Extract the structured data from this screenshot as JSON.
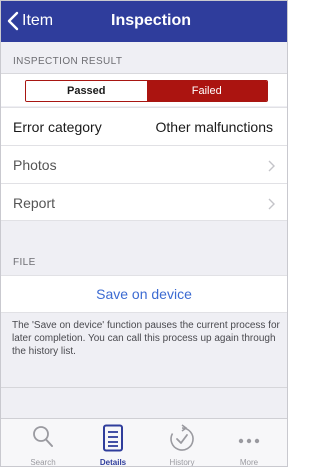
{
  "navbar": {
    "back_label": "Item",
    "title": "Inspection"
  },
  "inspection_result": {
    "header": "INSPECTION RESULT",
    "options": [
      "Passed",
      "Failed"
    ],
    "selected": "Failed"
  },
  "rows": {
    "error_category": {
      "label": "Error category",
      "value": "Other malfunctions"
    },
    "photos": {
      "label": "Photos"
    },
    "report": {
      "label": "Report"
    }
  },
  "file": {
    "header": "FILE",
    "save_label": "Save on device",
    "help_text": "The 'Save on device' function pauses the current process for later completion. You can call this process up again through the history list."
  },
  "tabbar": {
    "tabs": [
      {
        "label": "Search",
        "icon": "search-icon"
      },
      {
        "label": "Details",
        "icon": "details-icon",
        "active": true
      },
      {
        "label": "History",
        "icon": "history-icon"
      },
      {
        "label": "More",
        "icon": "more-icon"
      }
    ]
  },
  "colors": {
    "navbar": "#2f3d9c",
    "failed": "#ab1410",
    "link": "#3c6bd2",
    "background": "#efeff4"
  }
}
